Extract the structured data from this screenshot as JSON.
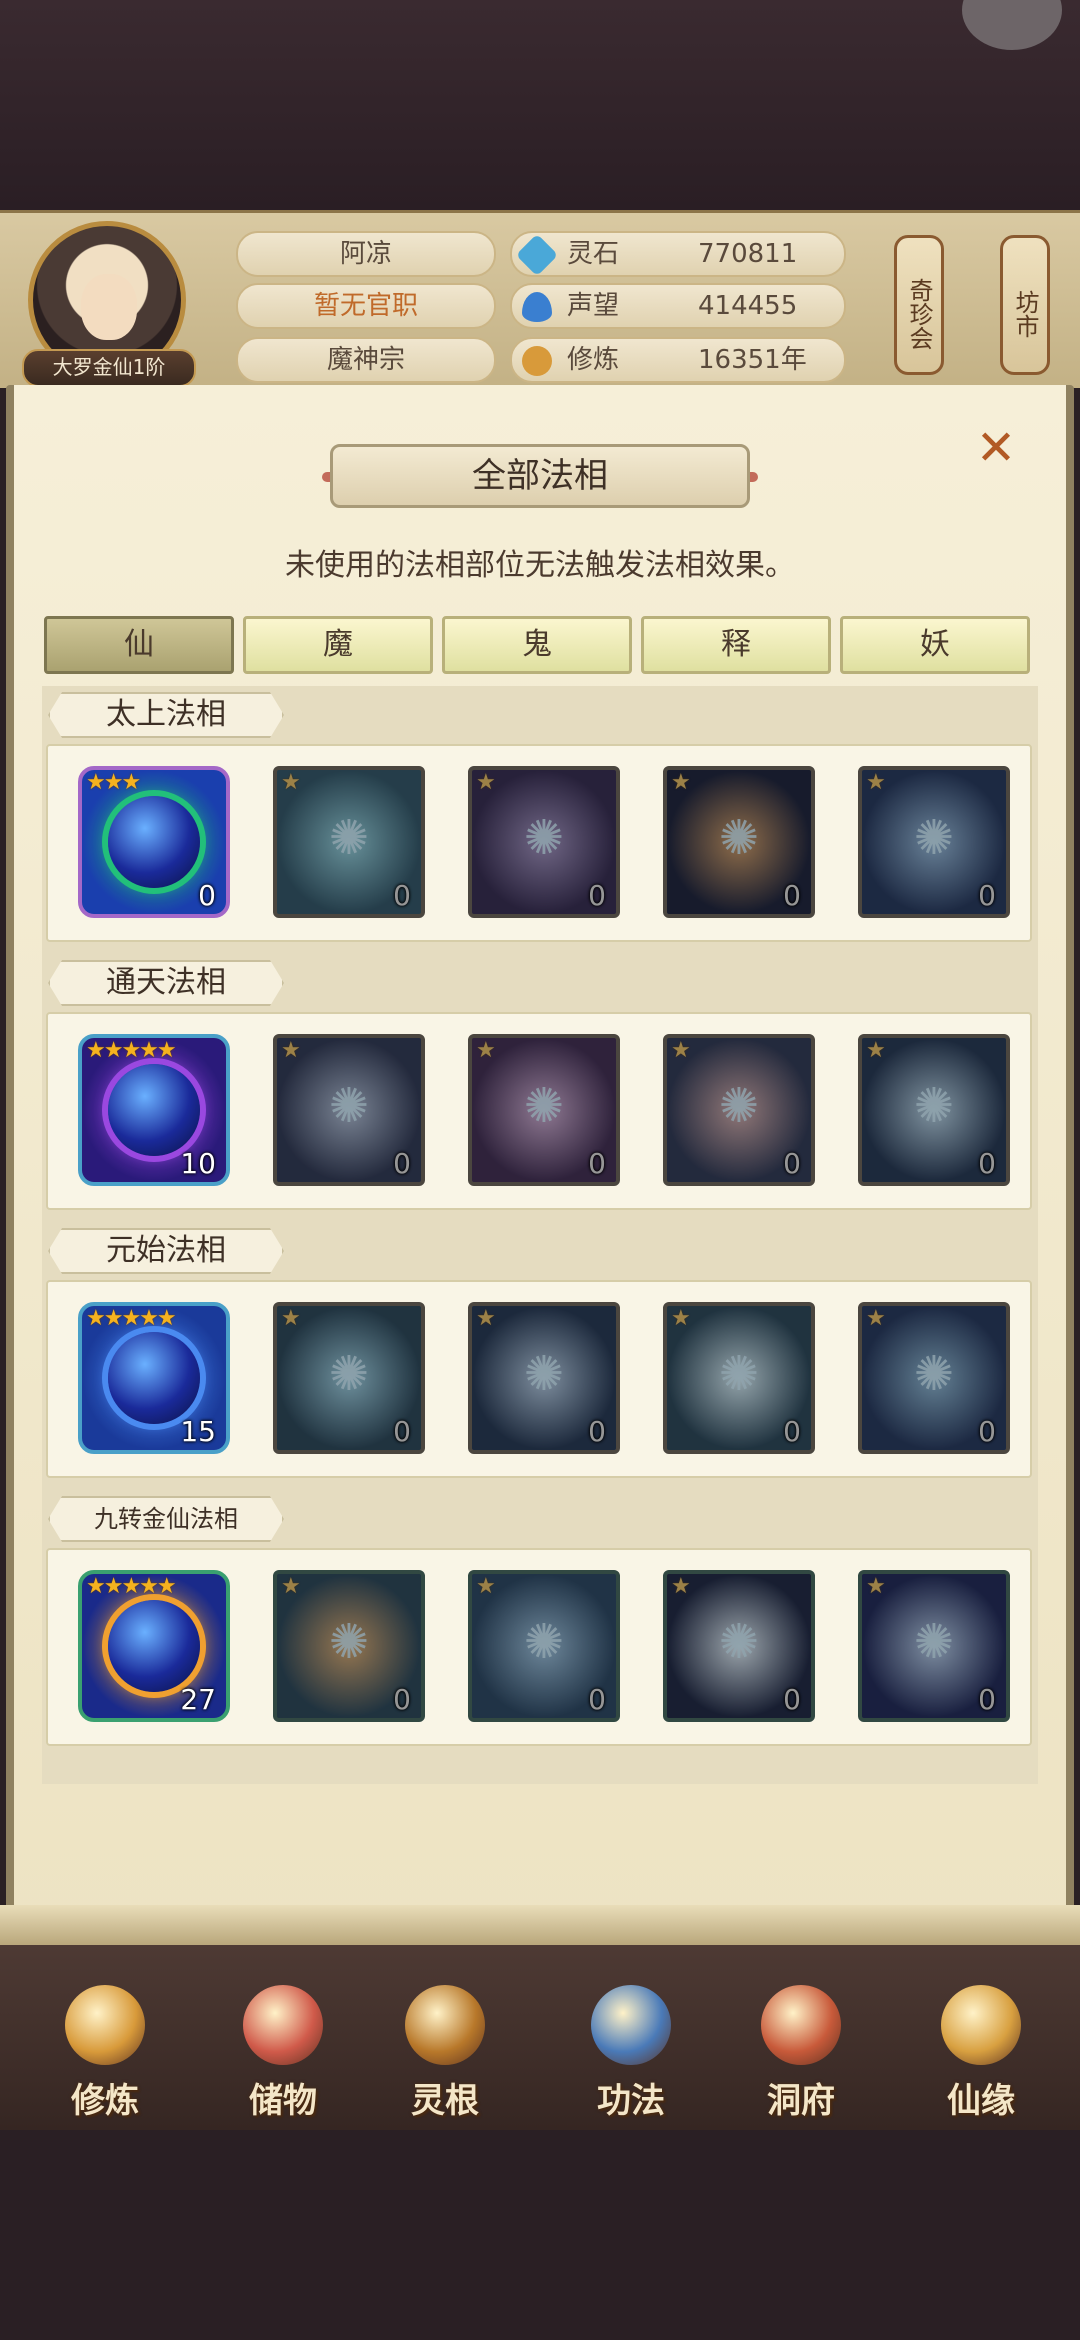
{
  "player": {
    "name": "阿凉",
    "title": "暂无官职",
    "sect": "魔神宗",
    "rank": "大罗金仙1阶"
  },
  "resources": [
    {
      "label": "灵石",
      "value": "770811",
      "icon": "spirit-stone-icon",
      "color": "#4aa8d8"
    },
    {
      "label": "声望",
      "value": "414455",
      "icon": "prestige-icon",
      "color": "#3a7fd0"
    },
    {
      "label": "修炼",
      "value": "16351年",
      "icon": "cultivation-icon",
      "color": "#d89a3a"
    }
  ],
  "side_buttons": [
    "奇珍会",
    "坊市"
  ],
  "panel": {
    "title": "全部法相",
    "subtitle": "未使用的法相部位无法触发法相效果。",
    "close_icon": "close-icon"
  },
  "tabs": [
    "仙",
    "魔",
    "鬼",
    "释",
    "妖"
  ],
  "active_tab": 0,
  "sections": [
    {
      "name": "太上法相",
      "items": [
        {
          "stars": 3,
          "count": "0",
          "owned": true,
          "colors": [
            "#1a3fae",
            "#22c07a"
          ],
          "frame": "#a468c8"
        },
        {
          "stars": 1,
          "count": "0",
          "owned": false,
          "colors": [
            "#1c5a7a",
            "#6ad2e8"
          ],
          "frame": "#6c6150"
        },
        {
          "stars": 1,
          "count": "0",
          "owned": false,
          "colors": [
            "#3a2a6a",
            "#a38ad8"
          ],
          "frame": "#6c6150"
        },
        {
          "stars": 1,
          "count": "0",
          "owned": false,
          "colors": [
            "#1a2550",
            "#e8923a"
          ],
          "frame": "#6c6150"
        },
        {
          "stars": 1,
          "count": "0",
          "owned": false,
          "colors": [
            "#1a3a7a",
            "#7ab8f0"
          ],
          "frame": "#6c6150"
        }
      ]
    },
    {
      "name": "通天法相",
      "items": [
        {
          "stars": 5,
          "count": "10",
          "owned": true,
          "colors": [
            "#2a1a7a",
            "#9a48e0"
          ],
          "frame": "#4aa0c8"
        },
        {
          "stars": 1,
          "count": "0",
          "owned": false,
          "colors": [
            "#2a3a6a",
            "#a0b8e0"
          ],
          "frame": "#6c6150"
        },
        {
          "stars": 1,
          "count": "0",
          "owned": false,
          "colors": [
            "#4a2a6a",
            "#d8a0e0"
          ],
          "frame": "#6c6150"
        },
        {
          "stars": 1,
          "count": "0",
          "owned": false,
          "colors": [
            "#2a3a6a",
            "#e0a0a0"
          ],
          "frame": "#6c6150"
        },
        {
          "stars": 1,
          "count": "0",
          "owned": false,
          "colors": [
            "#1a3a6a",
            "#a0d0f0"
          ],
          "frame": "#6c6150"
        }
      ]
    },
    {
      "name": "元始法相",
      "items": [
        {
          "stars": 5,
          "count": "15",
          "owned": true,
          "colors": [
            "#1a3a9a",
            "#4a8af0"
          ],
          "frame": "#4aa0c8"
        },
        {
          "stars": 1,
          "count": "0",
          "owned": false,
          "colors": [
            "#1a4a6a",
            "#7ad0f0"
          ],
          "frame": "#6c6150"
        },
        {
          "stars": 1,
          "count": "0",
          "owned": false,
          "colors": [
            "#1a3a6a",
            "#a0c8f0"
          ],
          "frame": "#6c6150"
        },
        {
          "stars": 1,
          "count": "0",
          "owned": false,
          "colors": [
            "#1a4a6a",
            "#c0e8f8"
          ],
          "frame": "#6c6150"
        },
        {
          "stars": 1,
          "count": "0",
          "owned": false,
          "colors": [
            "#1a3a7a",
            "#70b8e8"
          ],
          "frame": "#6c6150"
        }
      ]
    },
    {
      "name": "九转金仙法相",
      "items": [
        {
          "stars": 5,
          "count": "27",
          "owned": true,
          "colors": [
            "#1a2a8a",
            "#f0a030"
          ],
          "frame": "#3aa070"
        },
        {
          "stars": 1,
          "count": "0",
          "owned": false,
          "colors": [
            "#1a4a6a",
            "#f0a040"
          ],
          "frame": "#2f6a5a"
        },
        {
          "stars": 1,
          "count": "0",
          "owned": false,
          "colors": [
            "#1a4a7a",
            "#80c0f0"
          ],
          "frame": "#2f6a5a"
        },
        {
          "stars": 1,
          "count": "0",
          "owned": false,
          "colors": [
            "#1a2a5a",
            "#d0e8f8"
          ],
          "frame": "#2f6a5a"
        },
        {
          "stars": 1,
          "count": "0",
          "owned": false,
          "colors": [
            "#1a2a7a",
            "#a0c8f8"
          ],
          "frame": "#2f6a5a"
        }
      ]
    }
  ],
  "nav": [
    {
      "label": "修炼",
      "icon": "meditation-icon",
      "color": "#d89a3a"
    },
    {
      "label": "储物",
      "icon": "storage-bag-icon",
      "color": "#d05a4a"
    },
    {
      "label": "灵根",
      "icon": "spirit-root-icon",
      "color": "#b8782a"
    },
    {
      "label": "功法",
      "icon": "manual-book-icon",
      "color": "#4a7ab8"
    },
    {
      "label": "洞府",
      "icon": "cave-dwelling-icon",
      "color": "#c85a3a"
    },
    {
      "label": "仙缘",
      "icon": "gourd-icon",
      "color": "#d8a040"
    }
  ]
}
